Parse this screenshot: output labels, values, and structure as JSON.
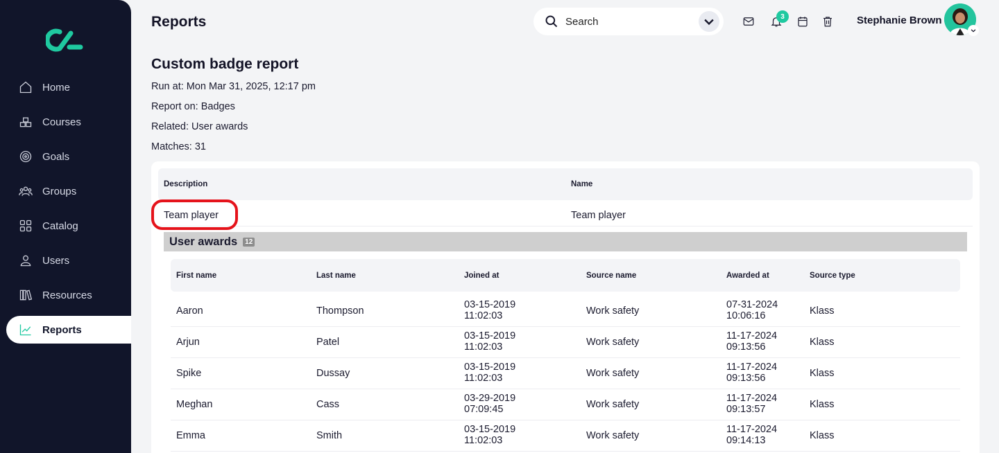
{
  "sidebar": {
    "items": [
      {
        "label": "Home",
        "icon": "home-icon"
      },
      {
        "label": "Courses",
        "icon": "courses-icon"
      },
      {
        "label": "Goals",
        "icon": "goals-icon"
      },
      {
        "label": "Groups",
        "icon": "groups-icon"
      },
      {
        "label": "Catalog",
        "icon": "catalog-icon"
      },
      {
        "label": "Users",
        "icon": "users-icon"
      },
      {
        "label": "Resources",
        "icon": "resources-icon"
      },
      {
        "label": "Reports",
        "icon": "reports-icon",
        "active": true
      }
    ]
  },
  "header": {
    "title": "Reports",
    "search_placeholder": "Search",
    "notification_count": "3",
    "user_name": "Stephanie Brown"
  },
  "report": {
    "title": "Custom badge report",
    "run_at": "Run at: Mon Mar 31, 2025, 12:17 pm",
    "report_on": "Report on: Badges",
    "related": "Related: User awards",
    "matches": "Matches: 31",
    "columns": {
      "description": "Description",
      "name": "Name"
    },
    "row": {
      "description": "Team player",
      "name": "Team player"
    },
    "sub": {
      "title": "User awards",
      "count": "12",
      "columns": {
        "first_name": "First name",
        "last_name": "Last name",
        "joined_at": "Joined at",
        "source_name": "Source name",
        "awarded_at": "Awarded at",
        "source_type": "Source type"
      },
      "rows": [
        {
          "first": "Aaron",
          "last": "Thompson",
          "joined_date": "03-15-2019",
          "joined_time": "11:02:03",
          "source": "Work safety",
          "awarded_date": "07-31-2024",
          "awarded_time": "10:06:16",
          "type": "Klass"
        },
        {
          "first": "Arjun",
          "last": "Patel",
          "joined_date": "03-15-2019",
          "joined_time": "11:02:03",
          "source": "Work safety",
          "awarded_date": "11-17-2024",
          "awarded_time": "09:13:56",
          "type": "Klass"
        },
        {
          "first": "Spike",
          "last": "Dussay",
          "joined_date": "03-15-2019",
          "joined_time": "11:02:03",
          "source": "Work safety",
          "awarded_date": "11-17-2024",
          "awarded_time": "09:13:56",
          "type": "Klass"
        },
        {
          "first": "Meghan",
          "last": "Cass",
          "joined_date": "03-29-2019",
          "joined_time": "07:09:45",
          "source": "Work safety",
          "awarded_date": "11-17-2024",
          "awarded_time": "09:13:57",
          "type": "Klass"
        },
        {
          "first": "Emma",
          "last": "Smith",
          "joined_date": "03-15-2019",
          "joined_time": "11:02:03",
          "source": "Work safety",
          "awarded_date": "11-17-2024",
          "awarded_time": "09:14:13",
          "type": "Klass"
        }
      ]
    }
  },
  "colors": {
    "sidebar": "#11152a",
    "accent": "#1fc9a0",
    "highlight": "#e5131b"
  }
}
